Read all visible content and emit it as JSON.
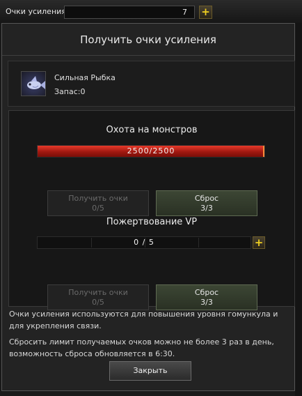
{
  "topbar": {
    "label": "Очки усиления",
    "value": "7",
    "plus": "+"
  },
  "dialog": {
    "title": "Получить очки усиления",
    "item": {
      "name": "Сильная Рыбка",
      "stock": "Запас:0"
    },
    "hunt": {
      "title": "Охота на монстров",
      "progress_text": "2500/2500",
      "progress_fraction": 1.0,
      "get_button": {
        "line1": "Получить очки",
        "line2": "0/5"
      },
      "reset_button": {
        "line1": "Сброс",
        "line2": "3/3"
      }
    },
    "donation": {
      "title": "Пожертвование VP",
      "progress_text": "0 / 5",
      "progress_fraction": 0.0,
      "plus": "+",
      "get_button": {
        "line1": "Получить очки",
        "line2": "0/5"
      },
      "reset_button": {
        "line1": "Сброс",
        "line2": "3/3"
      }
    },
    "info": [
      "Очки усиления используются для повышения уровня гомункула и для укрепления связи.",
      "Сбросить лимит получаемых очков можно не более 3 раз в день, возможность сброса обновляется в 6:30."
    ],
    "close_label": "Закрыть"
  },
  "colors": {
    "progress_red": "#b01c12",
    "reset_green": "#3c4634",
    "plus_yellow": "#f0d020"
  },
  "icons": {
    "item": "fish-icon",
    "plus": "plus-icon"
  }
}
